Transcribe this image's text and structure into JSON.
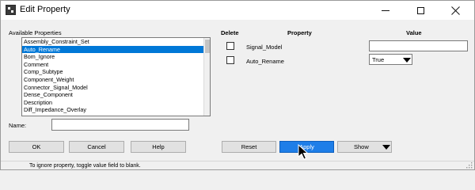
{
  "window": {
    "title": "Edit Property"
  },
  "left": {
    "available_label": "Available Properties",
    "properties": [
      "Assembly_Constraint_Set",
      "Auto_Rename",
      "Bom_Ignore",
      "Comment",
      "Comp_Subtype",
      "Component_Weight",
      "Connector_Signal_Model",
      "Dense_Component",
      "Description",
      "Diff_Impedance_Overlay"
    ],
    "selected_property": "Auto_Rename",
    "name_label": "Name:",
    "name_value": "",
    "ok_label": "OK",
    "cancel_label": "Cancel",
    "help_label": "Help"
  },
  "right": {
    "col_delete": "Delete",
    "col_property": "Property",
    "col_value": "Value",
    "rows": [
      {
        "property": "Signal_Model",
        "value": "",
        "deleted": false
      },
      {
        "property": "Auto_Rename",
        "value": "True",
        "deleted": false
      }
    ],
    "reset_label": "Reset",
    "apply_label": "Apply",
    "show_label": "Show"
  },
  "status": {
    "text": "To ignore property, toggle value field to blank."
  },
  "colors": {
    "selection": "#0078d7",
    "primary_button": "#1e7ee8"
  },
  "icons": [
    "app-icon",
    "minimize-icon",
    "maximize-icon",
    "close-icon",
    "chevron-down-icon",
    "resize-grip-icon",
    "cursor-icon"
  ]
}
